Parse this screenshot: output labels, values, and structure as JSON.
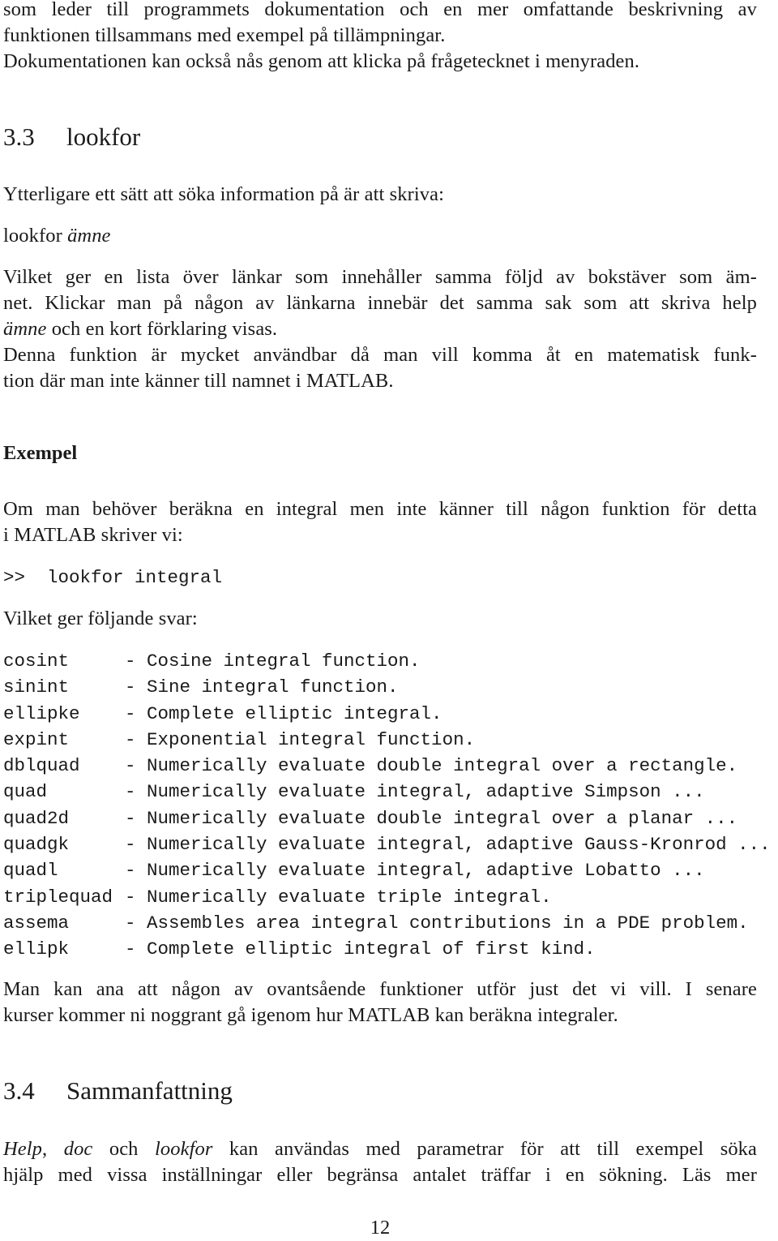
{
  "intro": {
    "lines": [
      "som leder till programmets dokumentation och en mer omfattande beskrivning av",
      "funktionen tillsammans med exempel på tillämpningar.",
      "Dokumentationen kan också nås genom att klicka på frågetecknet i menyraden."
    ]
  },
  "section_3_3": {
    "number": "3.3",
    "title": "lookfor",
    "intro": "Ytterligare ett sätt att söka information på är att skriva:",
    "syntax": {
      "command": "lookfor",
      "argument": "ämne"
    },
    "description": {
      "line1": "Vilket ger en lista över länkar som innehåller samma följd av bokstäver som äm-",
      "line2": "net. Klickar man på någon av länkarna innebär det samma sak som att skriva help",
      "line3_arg": "ämne",
      "line3_rest": " och en kort förklaring visas.",
      "line4": "Denna funktion är mycket användbar då man vill komma åt en matematisk funk-",
      "line5": "tion där man inte känner till namnet i MATLAB."
    },
    "example": {
      "heading": "Exempel",
      "intro_line1": "Om man behöver beräkna en integral men inte känner till någon funktion för detta",
      "intro_line2": "i MATLAB skriver vi:",
      "prompt": ">>",
      "command": "lookfor integral",
      "result_intro": "Vilket ger följande svar:",
      "results": [
        {
          "name": "cosint",
          "description": "- Cosine integral function."
        },
        {
          "name": "sinint",
          "description": "- Sine integral function."
        },
        {
          "name": "ellipke",
          "description": "- Complete elliptic integral."
        },
        {
          "name": "expint",
          "description": "- Exponential integral function."
        },
        {
          "name": "dblquad",
          "description": "- Numerically evaluate double integral over a rectangle."
        },
        {
          "name": "quad",
          "description": "- Numerically evaluate integral, adaptive Simpson ..."
        },
        {
          "name": "quad2d",
          "description": "- Numerically evaluate double integral over a planar ..."
        },
        {
          "name": "quadgk",
          "description": "- Numerically evaluate integral, adaptive Gauss-Kronrod ..."
        },
        {
          "name": "quadl",
          "description": "- Numerically evaluate integral, adaptive Lobatto ..."
        },
        {
          "name": "triplequad",
          "description": "- Numerically evaluate triple integral."
        },
        {
          "name": "assema",
          "description": "- Assembles area integral contributions in a PDE problem."
        },
        {
          "name": "ellipk",
          "description": "- Complete elliptic integral of first kind."
        }
      ],
      "conclusion_line1": "Man kan ana att någon av ovantsående funktioner utför just det vi vill. I senare",
      "conclusion_line2": "kurser kommer ni noggrant gå igenom hur MATLAB kan beräkna integraler."
    }
  },
  "section_3_4": {
    "number": "3.4",
    "title": "Sammanfattning",
    "line1": {
      "term1": "Help",
      "sep1": ", ",
      "term2": "doc",
      "sep2": " och ",
      "term3": "lookfor",
      "rest": " kan användas med parametrar för att till exempel söka"
    },
    "line2": "hjälp med vissa inställningar eller begränsa antalet träffar i en sökning. Läs mer"
  },
  "footer": {
    "page_number": "12"
  }
}
